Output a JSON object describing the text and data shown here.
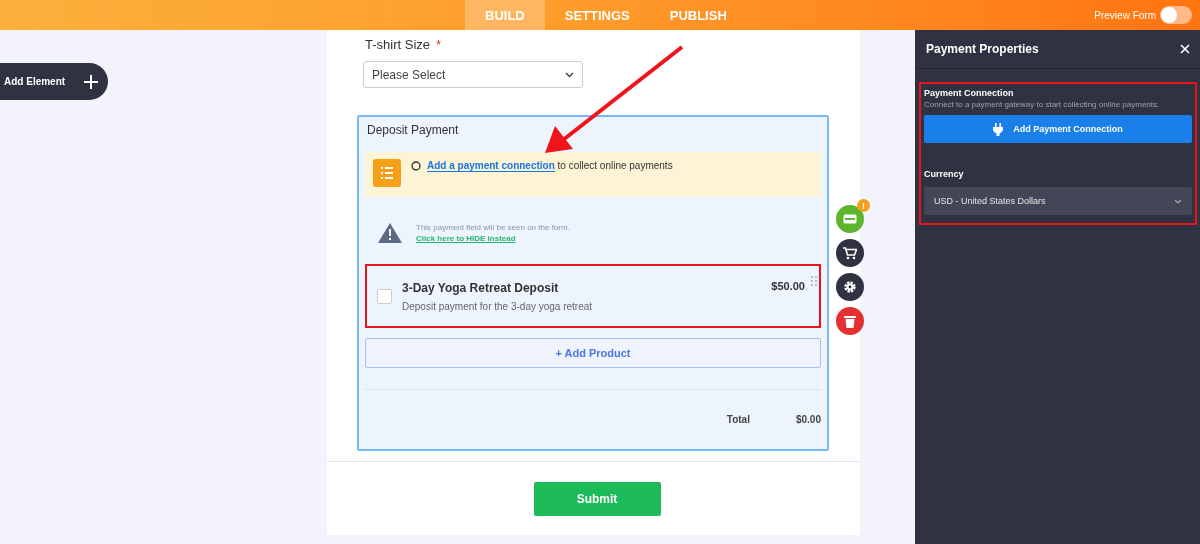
{
  "top_bar": {
    "tabs": [
      {
        "label": "BUILD",
        "selected": true
      },
      {
        "label": "SETTINGS",
        "selected": false
      },
      {
        "label": "PUBLISH",
        "selected": false
      }
    ],
    "preview_form": {
      "label": "Preview Form",
      "on": false
    }
  },
  "sidebar": {
    "add_element": "Add Element"
  },
  "form": {
    "tshirt": {
      "label": "T-shirt Size",
      "required_mark": "*",
      "placeholder": "Please Select"
    },
    "deposit": {
      "title": "Deposit Payment",
      "notice": {
        "link": "Add a payment connection",
        "text": "to collect online payments"
      },
      "visibility": {
        "message": "This payment field will be seen on the form.",
        "link": "Click here to HIDE instead"
      },
      "products": [
        {
          "name": "3-Day Yoga Retreat Deposit",
          "description": "Deposit payment for the 3-day yoga retreat",
          "price": "$50.00",
          "checked": false,
          "highlighted": true
        }
      ],
      "add_product": "+ Add Product",
      "total": {
        "label": "Total",
        "value": "$0.00"
      }
    },
    "submit": "Submit"
  },
  "side_actions": [
    {
      "kind": "payment",
      "badge": "!"
    },
    {
      "kind": "cart"
    },
    {
      "kind": "settings"
    },
    {
      "kind": "delete"
    }
  ],
  "panel": {
    "title": "Payment Properties",
    "connection": {
      "title": "Payment Connection",
      "description": "Connect to a payment gateway to start collecting online payments.",
      "button": "Add Payment Connection",
      "highlighted": true
    },
    "currency": {
      "label": "Currency",
      "value": "USD - United States Dollars"
    }
  }
}
